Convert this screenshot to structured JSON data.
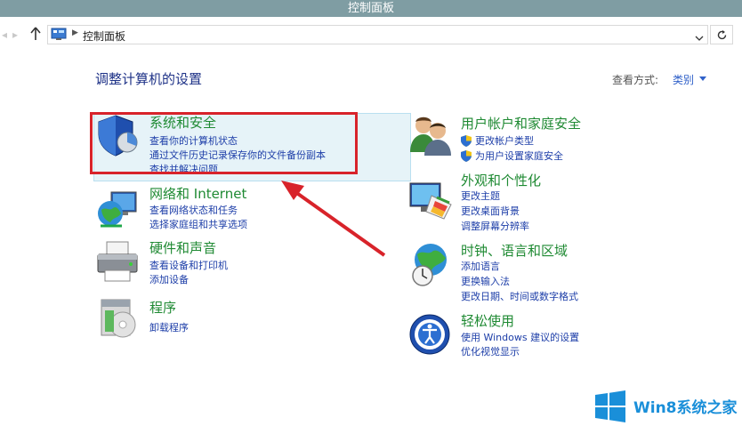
{
  "window": {
    "title": "控制面板"
  },
  "addressbar": {
    "path": "控制面板"
  },
  "page": {
    "heading": "调整计算机的设置",
    "view_by_label": "查看方式:",
    "view_by_value": "类别"
  },
  "categories": {
    "security": {
      "title": "系统和安全",
      "links": [
        "查看你的计算机状态",
        "通过文件历史记录保存你的文件备份副本",
        "查找并解决问题"
      ]
    },
    "network": {
      "title": "网络和 Internet",
      "links": [
        "查看网络状态和任务",
        "选择家庭组和共享选项"
      ]
    },
    "hardware": {
      "title": "硬件和声音",
      "links": [
        "查看设备和打印机",
        "添加设备"
      ]
    },
    "programs": {
      "title": "程序",
      "links": [
        "卸载程序"
      ]
    },
    "users": {
      "title": "用户帐户和家庭安全",
      "links": [
        "更改帐户类型",
        "为用户设置家庭安全"
      ]
    },
    "appearance": {
      "title": "外观和个性化",
      "links": [
        "更改主题",
        "更改桌面背景",
        "调整屏幕分辨率"
      ]
    },
    "clock": {
      "title": "时钟、语言和区域",
      "links": [
        "添加语言",
        "更换输入法",
        "更改日期、时间或数字格式"
      ]
    },
    "ease": {
      "title": "轻松使用",
      "links": [
        "使用 Windows 建议的设置",
        "优化视觉显示"
      ]
    }
  },
  "watermark": {
    "text": "Win8系统之家"
  },
  "colors": {
    "title_bar": "#7f9da3",
    "category_title": "#1f8a33",
    "link": "#1d3ea8",
    "annotation": "#d8232a"
  },
  "icons": {
    "security": "shield-icon",
    "network": "globe-network-icon",
    "hardware": "printer-icon",
    "programs": "programs-icon",
    "users": "users-icon",
    "appearance": "display-icon",
    "clock": "clock-globe-icon",
    "ease": "ease-of-access-icon"
  }
}
